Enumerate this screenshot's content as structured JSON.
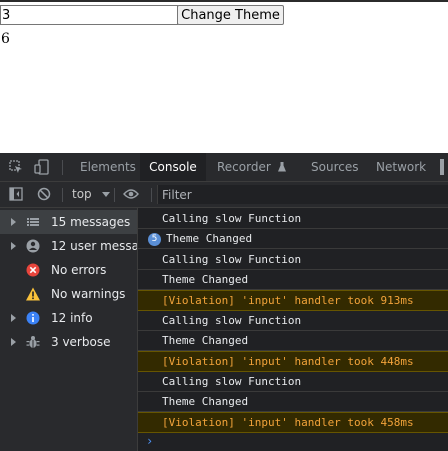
{
  "page": {
    "input_value": "3",
    "button_label": "Change Theme",
    "result": "6"
  },
  "devtools": {
    "tabs": [
      {
        "label": "Elements"
      },
      {
        "label": "Console"
      },
      {
        "label": "Recorder"
      },
      {
        "label": "Sources"
      },
      {
        "label": "Network"
      }
    ],
    "context": "top",
    "filter_placeholder": "Filter",
    "sidebar": [
      {
        "label": "15 messages",
        "icon": "list-icon"
      },
      {
        "label": "12 user messa...",
        "icon": "user-icon"
      },
      {
        "label": "No errors",
        "icon": "error-icon"
      },
      {
        "label": "No warnings",
        "icon": "warning-icon"
      },
      {
        "label": "12 info",
        "icon": "info-icon"
      },
      {
        "label": "3 verbose",
        "icon": "bug-icon"
      }
    ],
    "messages": [
      {
        "text": "Calling slow Function",
        "type": "log"
      },
      {
        "text": "Theme Changed",
        "type": "log",
        "count": "5"
      },
      {
        "text": "Calling slow Function",
        "type": "log"
      },
      {
        "text": "Theme Changed",
        "type": "log"
      },
      {
        "text": "[Violation] 'input' handler took 913ms",
        "type": "warn"
      },
      {
        "text": "Calling slow Function",
        "type": "log"
      },
      {
        "text": "Theme Changed",
        "type": "log"
      },
      {
        "text": "[Violation] 'input' handler took 448ms",
        "type": "warn"
      },
      {
        "text": "Calling slow Function",
        "type": "log"
      },
      {
        "text": "Theme Changed",
        "type": "log"
      },
      {
        "text": "[Violation] 'input' handler took 458ms",
        "type": "warn"
      }
    ],
    "prompt": "›"
  },
  "colors": {
    "devtools_bg": "#202124",
    "warning_bg": "#332a00",
    "warning_text": "#f2a33a",
    "accent": "#4e94f8"
  }
}
